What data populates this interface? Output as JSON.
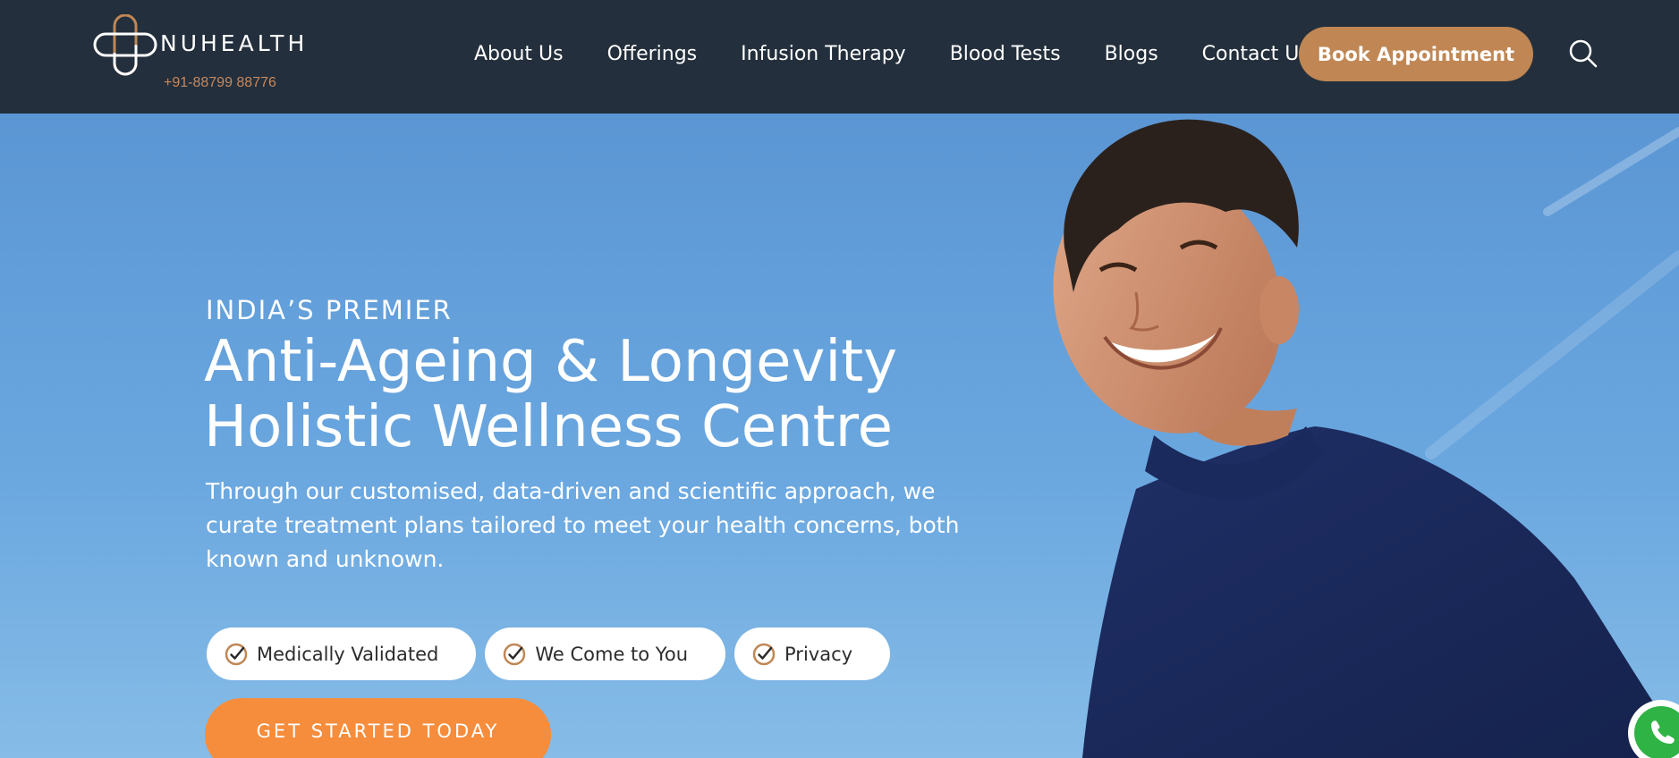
{
  "brand": {
    "name": "NUHEALTH",
    "phone": "+91-88799 88776",
    "accent_color": "#c08754"
  },
  "nav": {
    "items": [
      {
        "label": "About Us"
      },
      {
        "label": "Offerings"
      },
      {
        "label": "Infusion Therapy"
      },
      {
        "label": "Blood Tests"
      },
      {
        "label": "Blogs"
      },
      {
        "label": "Contact Us"
      }
    ],
    "book_label": "Book Appointment",
    "search_icon": "search-icon"
  },
  "hero": {
    "eyebrow": "INDIA’S PREMIER",
    "headline_line1": "Anti-Ageing & Longevity",
    "headline_line2": "Holistic Wellness Centre",
    "description": "Through our customised, data-driven and scientific approach, we curate treatment plans tailored to meet your health concerns, both known and unknown.",
    "features": [
      {
        "label": "Medically Validated",
        "icon": "check-circle-icon"
      },
      {
        "label": "We Come to You",
        "icon": "check-circle-icon"
      },
      {
        "label": "Privacy",
        "icon": "check-circle-icon"
      }
    ],
    "cta_label": "GET STARTED TODAY",
    "cta_color": "#f68d3c"
  },
  "floating": {
    "whatsapp_icon": "whatsapp-icon"
  }
}
